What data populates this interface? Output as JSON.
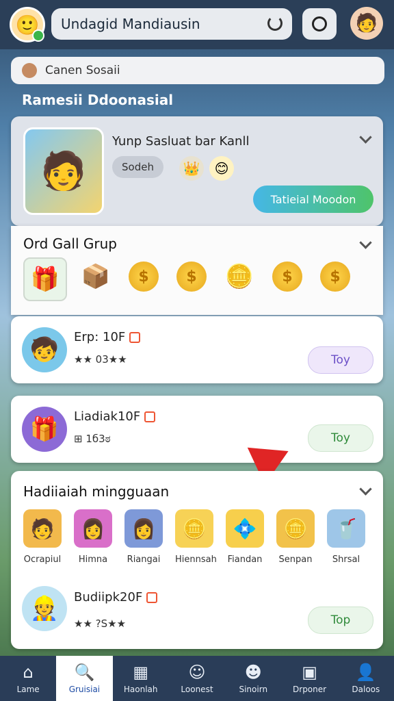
{
  "header": {
    "title": "Undagid Mandiausin",
    "search_placeholder": "Canen Sosaii"
  },
  "section_title": "Ramesii Ddoonasial",
  "featured": {
    "title": "Yunp Sasluat bar Kanll",
    "tag": "Sodeh",
    "button": "Tatieial Moodon"
  },
  "group": {
    "title": "Ord Gall Grup"
  },
  "items": [
    {
      "name": "Erp: 10F",
      "meta": "★★ 03★★",
      "button": "Toy"
    },
    {
      "name": "Liadiak10F",
      "meta": "⊞ 1б3ಠ",
      "button": "Toy"
    },
    {
      "name": "Budiipk20F",
      "meta": "★★ ?S★★",
      "button": "Top"
    }
  ],
  "weekly": {
    "title": "Hadiiaiah mingguaan",
    "items": [
      {
        "label": "Ocrapiul"
      },
      {
        "label": "Himna"
      },
      {
        "label": "Riangai"
      },
      {
        "label": "Hiennsah"
      },
      {
        "label": "Fiandan"
      },
      {
        "label": "Senpan"
      },
      {
        "label": "Shrsal"
      }
    ]
  },
  "nav": [
    {
      "label": "Lame",
      "icon": "home-icon"
    },
    {
      "label": "Gruisiai",
      "icon": "search-icon"
    },
    {
      "label": "Haonlah",
      "icon": "calendar-icon"
    },
    {
      "label": "Loonest",
      "icon": "face-icon"
    },
    {
      "label": "Sinoirn",
      "icon": "smile-icon"
    },
    {
      "label": "Drponer",
      "icon": "bag-icon"
    },
    {
      "label": "Daloos",
      "icon": "person-icon"
    }
  ],
  "colors": {
    "accent": "#45b7e6",
    "nav_bg": "#2a3d58",
    "red_badge": "#e02525"
  }
}
